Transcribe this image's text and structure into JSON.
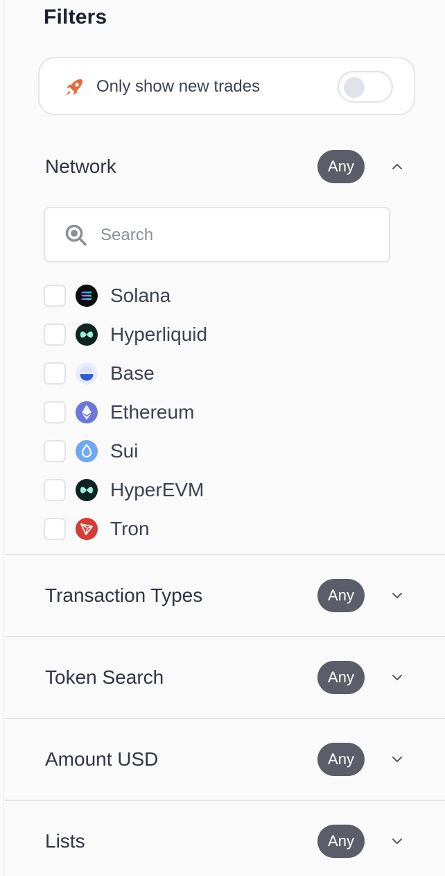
{
  "filters": {
    "title": "Filters",
    "new_trades": {
      "label": "Only show new trades",
      "enabled": false
    }
  },
  "network": {
    "title": "Network",
    "badge": "Any",
    "expanded": true,
    "search_placeholder": "Search",
    "items": [
      {
        "label": "Solana",
        "icon": "solana-icon",
        "checked": false
      },
      {
        "label": "Hyperliquid",
        "icon": "hyperliquid-icon",
        "checked": false
      },
      {
        "label": "Base",
        "icon": "base-icon",
        "checked": false
      },
      {
        "label": "Ethereum",
        "icon": "ethereum-icon",
        "checked": false
      },
      {
        "label": "Sui",
        "icon": "sui-icon",
        "checked": false
      },
      {
        "label": "HyperEVM",
        "icon": "hyperevm-icon",
        "checked": false
      },
      {
        "label": "Tron",
        "icon": "tron-icon",
        "checked": false
      }
    ]
  },
  "sections": [
    {
      "title": "Transaction Types",
      "badge": "Any"
    },
    {
      "title": "Token Search",
      "badge": "Any"
    },
    {
      "title": "Amount USD",
      "badge": "Any"
    },
    {
      "title": "Lists",
      "badge": "Any"
    }
  ],
  "colors": {
    "badge_bg": "#5b5e68",
    "rocket": "#e36b3c",
    "tron": "#d63b35",
    "ethereum": "#6b77d9",
    "sui": "#6ea7f2",
    "base": "#2f5bd8"
  }
}
